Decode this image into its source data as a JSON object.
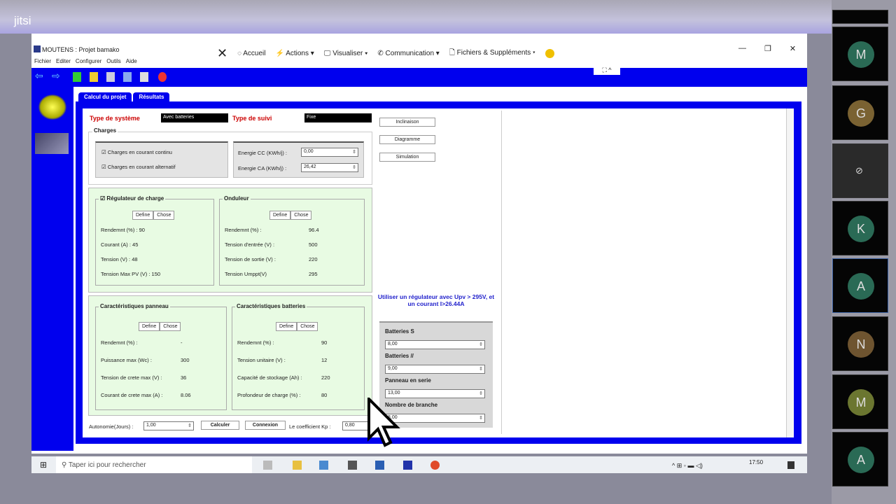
{
  "jitsi": {
    "logo": "jitsi",
    "participants": [
      {
        "initial": "M",
        "color": "#2a6a55"
      },
      {
        "initial": "G",
        "color": "#7a6232"
      },
      {
        "initial": "",
        "color": ""
      },
      {
        "initial": "K",
        "color": "#2a6a55"
      },
      {
        "initial": "A",
        "color": "#2a6a55"
      },
      {
        "initial": "N",
        "color": "#6e5430"
      },
      {
        "initial": "M",
        "color": "#6b7630"
      },
      {
        "initial": "A",
        "color": "#2a6a55"
      }
    ]
  },
  "app": {
    "title": "MOUTENS : Projet bamako",
    "menu": [
      "Fichier",
      "Editer",
      "Configurer",
      "Outils",
      "Aide"
    ],
    "anydesk": {
      "close": "✕",
      "home": "Accueil",
      "actions": "Actions ▾",
      "view": "Visualiser ▾",
      "comm": "Communication ▾",
      "files": "Fichiers & Suppléments ▾"
    },
    "window_controls": [
      "—",
      "❐",
      "✕"
    ],
    "tabs": [
      "Calcul du projet",
      "Résultats"
    ],
    "system_type_label": "Type de système",
    "system_type_value": "Avec batteries",
    "tracking_label": "Type de suivi",
    "tracking_value": "Fixe",
    "charges": {
      "title": "Charges",
      "dc": "Charges en courant continu",
      "ac": "Charges en courant alternatif",
      "energy_dc_label": "Energie CC (KWh/j) :",
      "energy_dc": "0,00",
      "energy_ac_label": "Energie CA (KWh/j) :",
      "energy_ac": "26,42"
    },
    "buttons": {
      "inclinaison": "Inclinaison",
      "diagramme": "Diagramme",
      "simulation": "Simulation",
      "define": "Define",
      "choose": "Chose",
      "calculer": "Calculer",
      "connexion": "Connexion"
    },
    "regulator": {
      "title": "Régulateur de charge",
      "rows": [
        [
          "Rendemnt (%) :",
          "90"
        ],
        [
          "Courant (A) :",
          "45"
        ],
        [
          "Tension (V) :",
          "48"
        ],
        [
          "Tension Max PV (V) :",
          "150"
        ]
      ]
    },
    "inverter": {
      "title": "Onduleur",
      "rows": [
        [
          "Rendemnt (%) :",
          "96.4"
        ],
        [
          "Tension d'entrée (V) :",
          "500"
        ],
        [
          "Tension de sortie (V) :",
          "220"
        ],
        [
          "Tension Umppt(V)",
          "295"
        ]
      ]
    },
    "panel": {
      "title": "Caractéristiques panneau",
      "rows": [
        [
          "Rendemnt (%) :",
          "-"
        ],
        [
          "Puissance max (Wc) :",
          "300"
        ],
        [
          "Tension de crete max (V) :",
          "36"
        ],
        [
          "Courant de crete max (A) :",
          "8.06"
        ]
      ]
    },
    "battery": {
      "title": "Caractéristiques batteries",
      "rows": [
        [
          "Rendemnt (%) :",
          "90"
        ],
        [
          "Tension unitaire (V) :",
          "12"
        ],
        [
          "Capacité de stockage (Ah) :",
          "220"
        ],
        [
          "Profondeur de charge (%) :",
          "80"
        ]
      ]
    },
    "advice": "Utiliser un régulateur avec Upv > 295V, et un courant I>26.44A",
    "results": [
      [
        "Batteries S",
        "8,00"
      ],
      [
        "Batteries //",
        "9,00"
      ],
      [
        "Panneau en serie",
        "13,00"
      ],
      [
        "Nombre de branche",
        "8,00"
      ]
    ],
    "autonomy_label": "Autonomie(Jours) :",
    "autonomy": "1,00",
    "kp_label": "Le coefficient Kp :",
    "kp": "0,80"
  },
  "taskbar": {
    "search": "Taper ici pour rechercher",
    "time": "17:50"
  }
}
